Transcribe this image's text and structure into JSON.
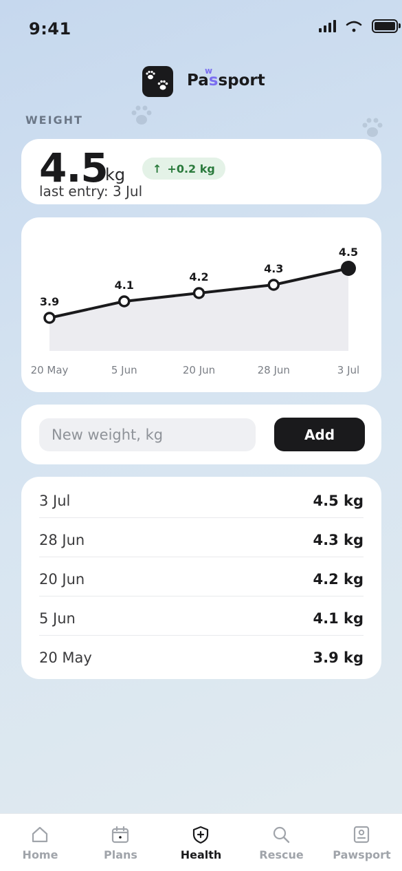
{
  "status_bar": {
    "time": "9:41"
  },
  "app": {
    "brand_prefix": "Pa",
    "brand_mid": "s",
    "brand_suffix": "sport",
    "brand_superscript": "w"
  },
  "weight": {
    "section_label": "WEIGHT",
    "current_value": "4.5",
    "unit": "kg",
    "last_entry": "last entry: 3 Jul",
    "delta_arrow": "↑",
    "delta_text": "+0.2 kg"
  },
  "chart_data": {
    "type": "line",
    "categories": [
      "20 May",
      "5 Jun",
      "20 Jun",
      "28 Jun",
      "3 Jul"
    ],
    "values": [
      3.9,
      4.1,
      4.2,
      4.3,
      4.5
    ],
    "labels": [
      "3.9",
      "4.1",
      "4.2",
      "4.3",
      "4.5"
    ],
    "title": "",
    "xlabel": "",
    "ylabel": "",
    "ylim": [
      3.5,
      4.7
    ],
    "grid": false,
    "colors": {
      "line": "#1a1a1c",
      "area": "#ececf0"
    }
  },
  "entry_form": {
    "placeholder": "New weight, kg",
    "value": "",
    "add_label": "Add"
  },
  "history": [
    {
      "date": "3 Jul",
      "value": "4.5 kg"
    },
    {
      "date": "28 Jun",
      "value": "4.3 kg"
    },
    {
      "date": "20 Jun",
      "value": "4.2 kg"
    },
    {
      "date": "5 Jun",
      "value": "4.1 kg"
    },
    {
      "date": "20 May",
      "value": "3.9 kg"
    }
  ],
  "tabs": [
    {
      "label": "Home",
      "icon": "home-icon",
      "active": false
    },
    {
      "label": "Plans",
      "icon": "calendar-icon",
      "active": false
    },
    {
      "label": "Health",
      "icon": "shield-plus-icon",
      "active": true
    },
    {
      "label": "Rescue",
      "icon": "search-icon",
      "active": false
    },
    {
      "label": "Pawsport",
      "icon": "passport-icon",
      "active": false
    }
  ]
}
